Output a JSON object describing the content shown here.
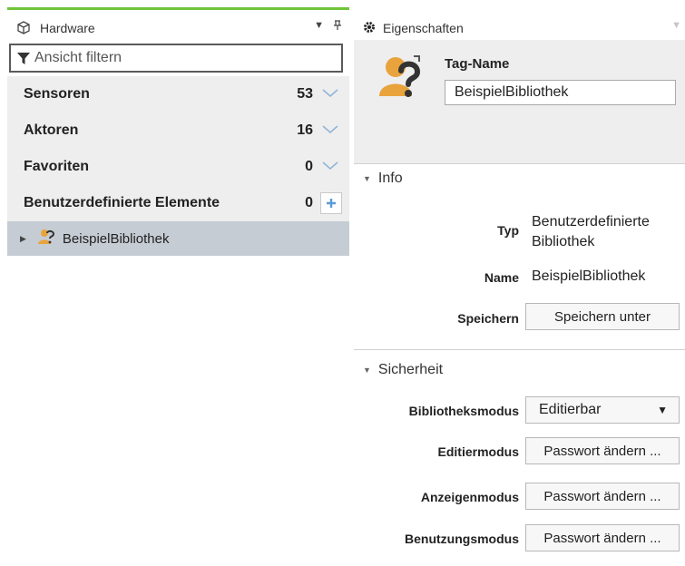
{
  "hardware_panel": {
    "title": "Hardware",
    "filter_placeholder": "Ansicht filtern",
    "groups": [
      {
        "label": "Sensoren",
        "count": "53"
      },
      {
        "label": "Aktoren",
        "count": "16"
      },
      {
        "label": "Favoriten",
        "count": "0"
      },
      {
        "label": "Benutzerdefinierte Elemente",
        "count": "0"
      }
    ],
    "library_item": "BeispielBibliothek"
  },
  "properties_panel": {
    "title": "Eigenschaften",
    "tag_name_label": "Tag-Name",
    "tag_name_value": "BeispielBibliothek",
    "info_section": {
      "title": "Info",
      "typ_label": "Typ",
      "typ_value": "Benutzerdefinierte Bibliothek",
      "name_label": "Name",
      "name_value": "BeispielBibliothek",
      "speichern_label": "Speichern",
      "speichern_button": "Speichern unter"
    },
    "security_section": {
      "title": "Sicherheit",
      "bibliotheksmodus_label": "Bibliotheksmodus",
      "bibliotheksmodus_value": "Editierbar",
      "editiermodus_label": "Editiermodus",
      "anzeigenmodus_label": "Anzeigenmodus",
      "benutzungsmodus_label": "Benutzungsmodus",
      "password_button": "Passwort ändern ..."
    }
  },
  "colors": {
    "accent_green": "#6fc33a",
    "panel_gray": "#eeeeee",
    "selected_row": "#c6ccd3",
    "chevron_blue": "#8fb4d6"
  }
}
